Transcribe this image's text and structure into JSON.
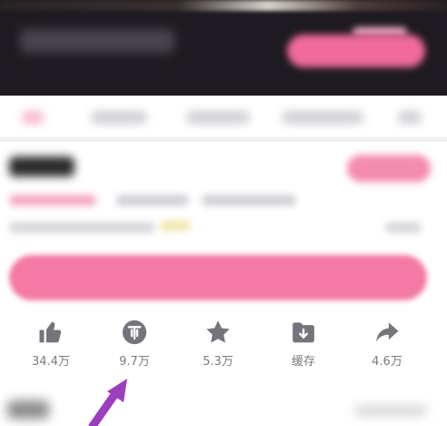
{
  "actions": [
    {
      "id": "like",
      "icon": "thumbs-up-icon",
      "label": "34.4万"
    },
    {
      "id": "coin",
      "icon": "coin-icon",
      "label": "9.7万"
    },
    {
      "id": "favorite",
      "icon": "star-icon",
      "label": "5.3万"
    },
    {
      "id": "cache",
      "icon": "download-folder-icon",
      "label": "缓存"
    },
    {
      "id": "share",
      "icon": "share-arrow-icon",
      "label": "4.6万"
    }
  ],
  "colors": {
    "icon": "#74747c",
    "label": "#7a7a82",
    "accent_pink": "#f47aa5",
    "annotation_arrow": "#9b3fc0"
  }
}
